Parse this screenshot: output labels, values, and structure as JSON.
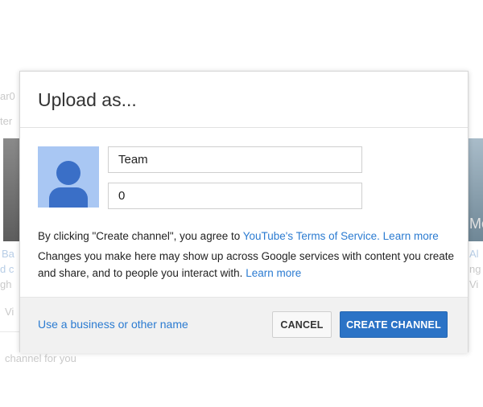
{
  "background": {
    "fragments": [
      "ar0",
      "ter",
      "Ba",
      "d c",
      "gh",
      "Vi",
      "Al",
      "Mc",
      "ng",
      "Vi",
      "channel for you"
    ]
  },
  "dialog": {
    "title": "Upload as...",
    "name_field_value": "Team",
    "second_field_value": "0",
    "agree_prefix": "By clicking \"Create channel\", you agree to ",
    "terms_link": "YouTube's Terms of Service.",
    "learn_more_1": "Learn more",
    "changes_text": "Changes you make here may show up across Google services with content you create and share, and to people you interact with.",
    "learn_more_2": "Learn more",
    "business_link": "Use a business or other name",
    "cancel_label": "CANCEL",
    "create_label": "CREATE CHANNEL"
  },
  "colors": {
    "accent": "#2b73c6",
    "link": "#2b7bd1",
    "avatar_bg": "#a9c7f3",
    "avatar_fg": "#3a6fc7"
  },
  "icons": {
    "avatar": "default-user-avatar-icon"
  }
}
